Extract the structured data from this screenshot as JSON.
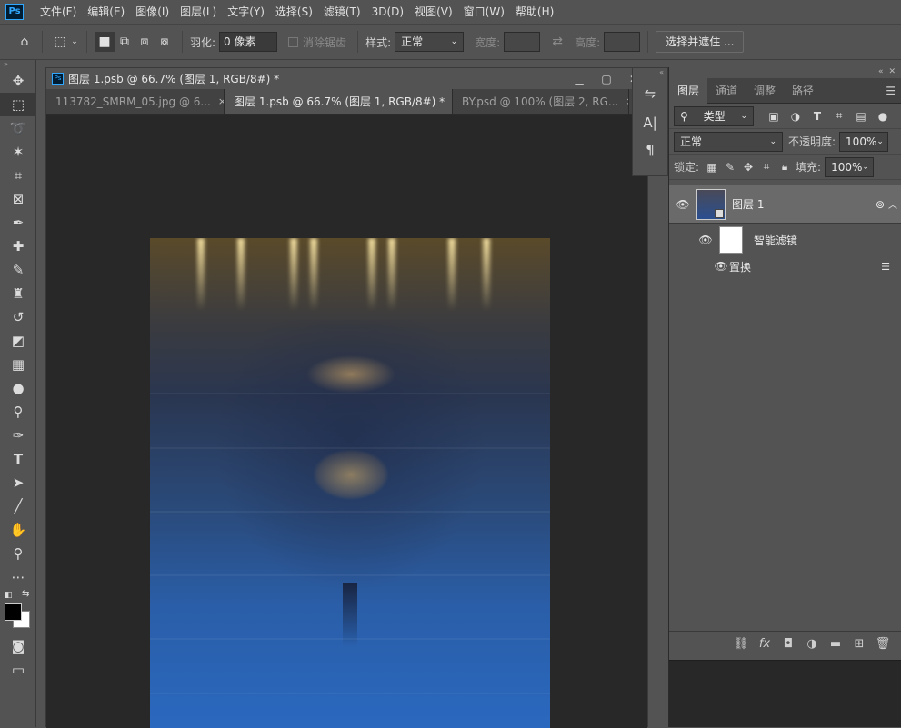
{
  "app": {
    "logo": "Ps"
  },
  "menu": [
    "文件(F)",
    "编辑(E)",
    "图像(I)",
    "图层(L)",
    "文字(Y)",
    "选择(S)",
    "滤镜(T)",
    "3D(D)",
    "视图(V)",
    "窗口(W)",
    "帮助(H)"
  ],
  "options": {
    "feather_label": "羽化:",
    "feather_value": "0 像素",
    "antialias_label": "消除锯齿",
    "style_label": "样式:",
    "style_value": "正常",
    "width_label": "宽度:",
    "height_label": "高度:",
    "select_mask_button": "选择并遮住 ..."
  },
  "document": {
    "title": "图层 1.psb @ 66.7% (图层 1, RGB/8#) *",
    "tabs": [
      {
        "label": "113782_SMRM_05.jpg @ 6...",
        "close": "×"
      },
      {
        "label": "图层 1.psb @ 66.7% (图层 1, RGB/8#) *",
        "close": "×"
      },
      {
        "label": "BY.psd @ 100% (图层 2, RG...",
        "close": "×"
      }
    ]
  },
  "panel": {
    "tabs": [
      "图层",
      "通道",
      "调整",
      "路径"
    ],
    "filter_kind": "类型",
    "blend_mode": "正常",
    "opacity_label": "不透明度:",
    "opacity_value": "100%",
    "lock_label": "锁定:",
    "fill_label": "填充:",
    "fill_value": "100%",
    "layers": [
      {
        "name": "图层 1"
      }
    ],
    "smart_filters_label": "智能滤镜",
    "filter_name": "置换"
  },
  "icons": {
    "tools": [
      "move-icon",
      "marquee-icon",
      "lasso-icon",
      "magic-wand-icon",
      "crop-icon",
      "frame-icon",
      "eyedropper-icon",
      "healing-icon",
      "brush-icon",
      "stamp-icon",
      "history-brush-icon",
      "eraser-icon",
      "gradient-icon",
      "blur-icon",
      "dodge-icon",
      "pen-icon",
      "type-icon",
      "path-select-icon",
      "line-icon",
      "hand-icon",
      "zoom-icon",
      "more-icon"
    ]
  }
}
